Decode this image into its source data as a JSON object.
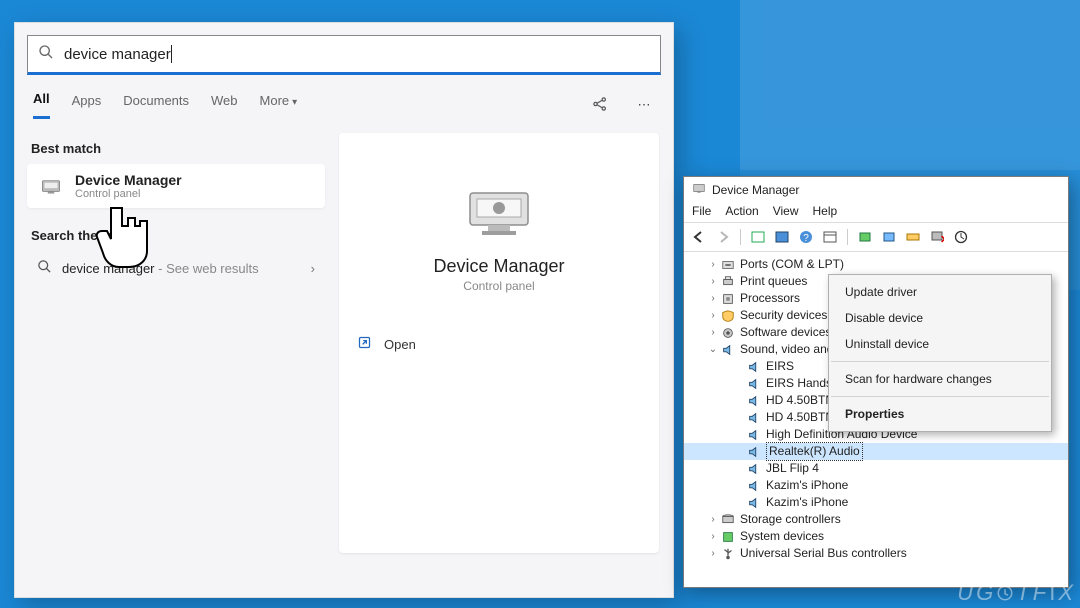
{
  "search": {
    "query": "device manager",
    "tabs": [
      "All",
      "Apps",
      "Documents",
      "Web",
      "More"
    ],
    "best_match_label": "Best match",
    "result_title": "Device Manager",
    "result_sub": "Control panel",
    "search_the_label": "Search the web",
    "web_result_label": "device manager",
    "web_result_sub": "See web results",
    "preview_title": "Device Manager",
    "preview_sub": "Control panel",
    "open_label": "Open"
  },
  "dm": {
    "title": "Device Manager",
    "menus": [
      "File",
      "Action",
      "View",
      "Help"
    ],
    "tree": {
      "collapsed": [
        {
          "label": "Ports (COM & LPT)",
          "icon": "port"
        },
        {
          "label": "Print queues",
          "icon": "printer"
        },
        {
          "label": "Processors",
          "icon": "cpu"
        },
        {
          "label": "Security devices",
          "icon": "shield"
        },
        {
          "label": "Software devices",
          "icon": "gear"
        }
      ],
      "expanded_label": "Sound, video and game controllers",
      "children": [
        "EIRS",
        "EIRS Hands-Free",
        "HD 4.50BTNC",
        "HD 4.50BTNC Hands-Free",
        "High Definition Audio Device",
        "Realtek(R) Audio",
        "JBL Flip 4",
        "Kazim's iPhone",
        "Kazim's iPhone"
      ],
      "selected_index": 5,
      "tail": [
        {
          "label": "Storage controllers",
          "icon": "storage"
        },
        {
          "label": "System devices",
          "icon": "chip"
        },
        {
          "label": "Universal Serial Bus controllers",
          "icon": "usb"
        }
      ]
    }
  },
  "context_menu": {
    "items": [
      {
        "label": "Update driver"
      },
      {
        "label": "Disable device"
      },
      {
        "label": "Uninstall device"
      },
      {
        "sep": true
      },
      {
        "label": "Scan for hardware changes"
      },
      {
        "sep": true
      },
      {
        "label": "Properties",
        "bold": true
      }
    ]
  },
  "watermark": "UGETFIX"
}
